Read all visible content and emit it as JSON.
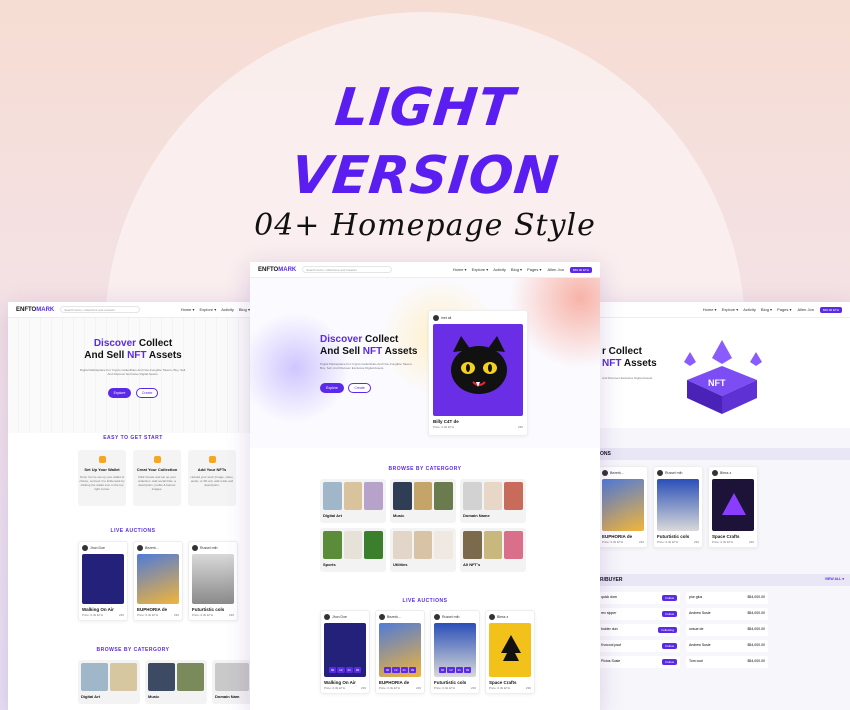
{
  "headline": {
    "line1": "LIGHT",
    "line2": "VERSION",
    "script": "04+ Homepage Style"
  },
  "colors": {
    "accent": "#5a2ae8",
    "brand_headline": "#5a1ff0"
  },
  "left_page": {
    "logo": "ENFTO",
    "logo_accent": "MARK",
    "search_placeholder": "Search items, collections and creators",
    "nav": [
      "Home ▾",
      "Explore ▾",
      "Activity",
      "Blog ▾"
    ],
    "hero_title_accent": "Discover",
    "hero_title_1": " Collect",
    "hero_title_2_pre": "And Sell ",
    "hero_title_2_acc": "NFT",
    "hero_title_2_post": " Assets",
    "hero_desc": "Digital Marketplace For Crypto Collectibles And Non-Fungible Tokens. Buy, Sell, And Discover Exclusive Digital Assets.",
    "btn_explore": "Explore",
    "btn_create": "Create",
    "steps_title": "EASY TO GET START",
    "steps": [
      {
        "title": "Set Up Your Wallet",
        "desc": "Once You've set up your wallet of choice, connect it to Enftomark by clicking the wallet icon in the top right corner."
      },
      {
        "title": "Creat Your Collection",
        "desc": "Click Create and set up your collection. Add social links, a description, profile & banner images."
      },
      {
        "title": "Add Your NFTs",
        "desc": "Upload your work (image, video, audio, or 3D art), add a title and description."
      }
    ],
    "auctions_title": "LIVE AUCTIONS",
    "auctions": [
      {
        "owner": "Jhon Doe",
        "name": "Walking On Air",
        "price": "Price: 0.3k ETH",
        "likes": "230"
      },
      {
        "owner": "Bezerk...",
        "name": "EUPHORIA de",
        "price": "Price: 0.3k ETH",
        "likes": "230"
      },
      {
        "owner": "Russel mth",
        "name": "Futurtistic cols",
        "price": "Price: 0.3k ETH",
        "likes": "230"
      }
    ],
    "browse_title": "BROWSE BY CATERGORY",
    "categories": [
      "Digital Art",
      "Music",
      "Domain Nam"
    ]
  },
  "center_page": {
    "logo": "ENFTO",
    "logo_accent": "MARK",
    "search_placeholder": "Search items, collections and creators",
    "nav": [
      "Home ▾",
      "Explore ▾",
      "Activity",
      "Blog ▾",
      "Pages ▾"
    ],
    "user": "Allen Jon",
    "wallet": "$56.00 ETH",
    "hero_title_accent": "Discover",
    "hero_title_1": " Collect",
    "hero_title_2_pre": "And Sell ",
    "hero_title_2_acc": "NFT",
    "hero_title_2_post": " Assets",
    "hero_desc": "Digital Marketplace For Crypto Collectibles And Non-Fungible Tokens. Buy, Sell, And Discover Exclusive Digital Assets.",
    "btn_explore": "Explore",
    "btn_create": "Create",
    "featured": {
      "owner": "Inet ali",
      "name": "Billy C4T de",
      "price": "Price: 0.3k ETH",
      "likes": "230"
    },
    "browse_title": "BROWSE BY CATERGORY",
    "categories": [
      "Digital Art",
      "Music",
      "Domain Name",
      "Sports",
      "Utilities",
      "All NFT's"
    ],
    "auctions_title": "LIVE AUCTIONS",
    "auctions": [
      {
        "owner": "Jhon Doe",
        "name": "Walking On Air",
        "price": "Price: 0.3k ETH",
        "likes": "230"
      },
      {
        "owner": "Bezerk...",
        "name": "EUPHORIA de",
        "price": "Price: 0.3k ETH",
        "likes": "230"
      },
      {
        "owner": "Russel mth",
        "name": "Futurtistic cols",
        "price": "Price: 0.3k ETH",
        "likes": "230"
      },
      {
        "owner": "Bless z",
        "name": "Space Crafts",
        "price": "Price: 0.3k ETH",
        "likes": "230"
      }
    ]
  },
  "right_page": {
    "nav": [
      "Home ▾",
      "Explore ▾",
      "Activity",
      "Blog ▾",
      "Pages ▾"
    ],
    "user": "Allen Jon",
    "wallet": "$56.00 ETH",
    "hero_title_1": "r Collect",
    "hero_title_2_acc": "NFT",
    "hero_title_2_post": " Assets",
    "hero_desc": "And Discover Exclusive Digital Assets.",
    "auctions_title": "ONS",
    "auctions": [
      {
        "owner": "Bezerk...",
        "name": "EUPHORIA de",
        "price": "Price: 0.3k ETH",
        "likes": "230"
      },
      {
        "owner": "Russel mth",
        "name": "Futurtistic cols",
        "price": "Price: 0.3k ETH",
        "likes": "230"
      },
      {
        "owner": "Bless z",
        "name": "Space Crafts",
        "price": "Price: 0.3k ETH",
        "likes": "230"
      }
    ],
    "sellers_title": "R/BUYER",
    "view_all": "VIEW ALL ▾",
    "sellers": [
      {
        "name": "quick dom",
        "val": "$34,000.00",
        "btn": "Follow",
        "name2": "plur glus",
        "val2": "$54,000.00"
      },
      {
        "name": "rex sipper",
        "val": "$34,000.00",
        "btn": "Follow",
        "name2": "Andrew Susie",
        "val2": "$54,000.00"
      },
      {
        "name": "bulder dun",
        "val": "$34,000.00",
        "btn": "Following",
        "name2": "unsue de",
        "val2": "$54,000.00"
      },
      {
        "name": "Kvncool psuf",
        "val": "$34,000.00",
        "btn": "Follow",
        "name2": "Andrew Susie",
        "val2": "$54,000.00"
      },
      {
        "name": "Pictus Susie",
        "val": "$34,000.00",
        "btn": "Follow",
        "name2": "Tom cool",
        "val2": "$54,000.00"
      }
    ]
  }
}
